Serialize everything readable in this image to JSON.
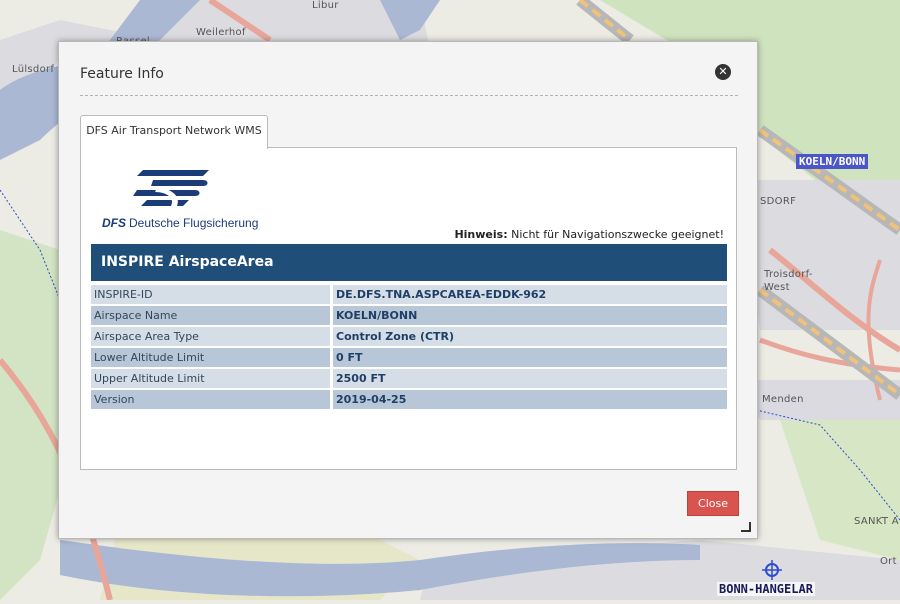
{
  "map": {
    "places": [
      "Libur",
      "Weilerhof",
      "Lülsdorf",
      "Troisdorf-\nWest",
      "Menden",
      "SANKT A",
      "Ort",
      "SDORF",
      "Rassel"
    ],
    "airspace_badge": "KOELN/BONN",
    "airfield_badge": "BONN-HANGELAR",
    "colors": {
      "land": "#ecebe4",
      "water": "#aab8d4",
      "forest": "#cfe3bf",
      "highway": "#e8a69a",
      "airspace": "#2b4bd0"
    }
  },
  "dialog": {
    "title": "Feature Info",
    "close_icon": "close-circle-icon",
    "tab_label": "DFS Air Transport Network WMS",
    "logo": {
      "mark": "DFS",
      "name": "Deutsche Flugsicherung"
    },
    "hint_label": "Hinweis:",
    "hint_text": "Nicht für Navigationszwecke geeignet!",
    "info_title": "INSPIRE AirspaceArea",
    "rows": [
      {
        "key": "INSPIRE-ID",
        "value": "DE.DFS.TNA.ASPCAREA-EDDK-962"
      },
      {
        "key": "Airspace Name",
        "value": "KOELN/BONN"
      },
      {
        "key": "Airspace Area Type",
        "value": "Control Zone (CTR)"
      },
      {
        "key": "Lower Altitude Limit",
        "value": "0 FT"
      },
      {
        "key": "Upper Altitude Limit",
        "value": "2500 FT"
      },
      {
        "key": "Version",
        "value": "2019-04-25"
      }
    ],
    "close_button": "Close",
    "accent_color": "#1f4e79",
    "close_color": "#d9534f"
  }
}
